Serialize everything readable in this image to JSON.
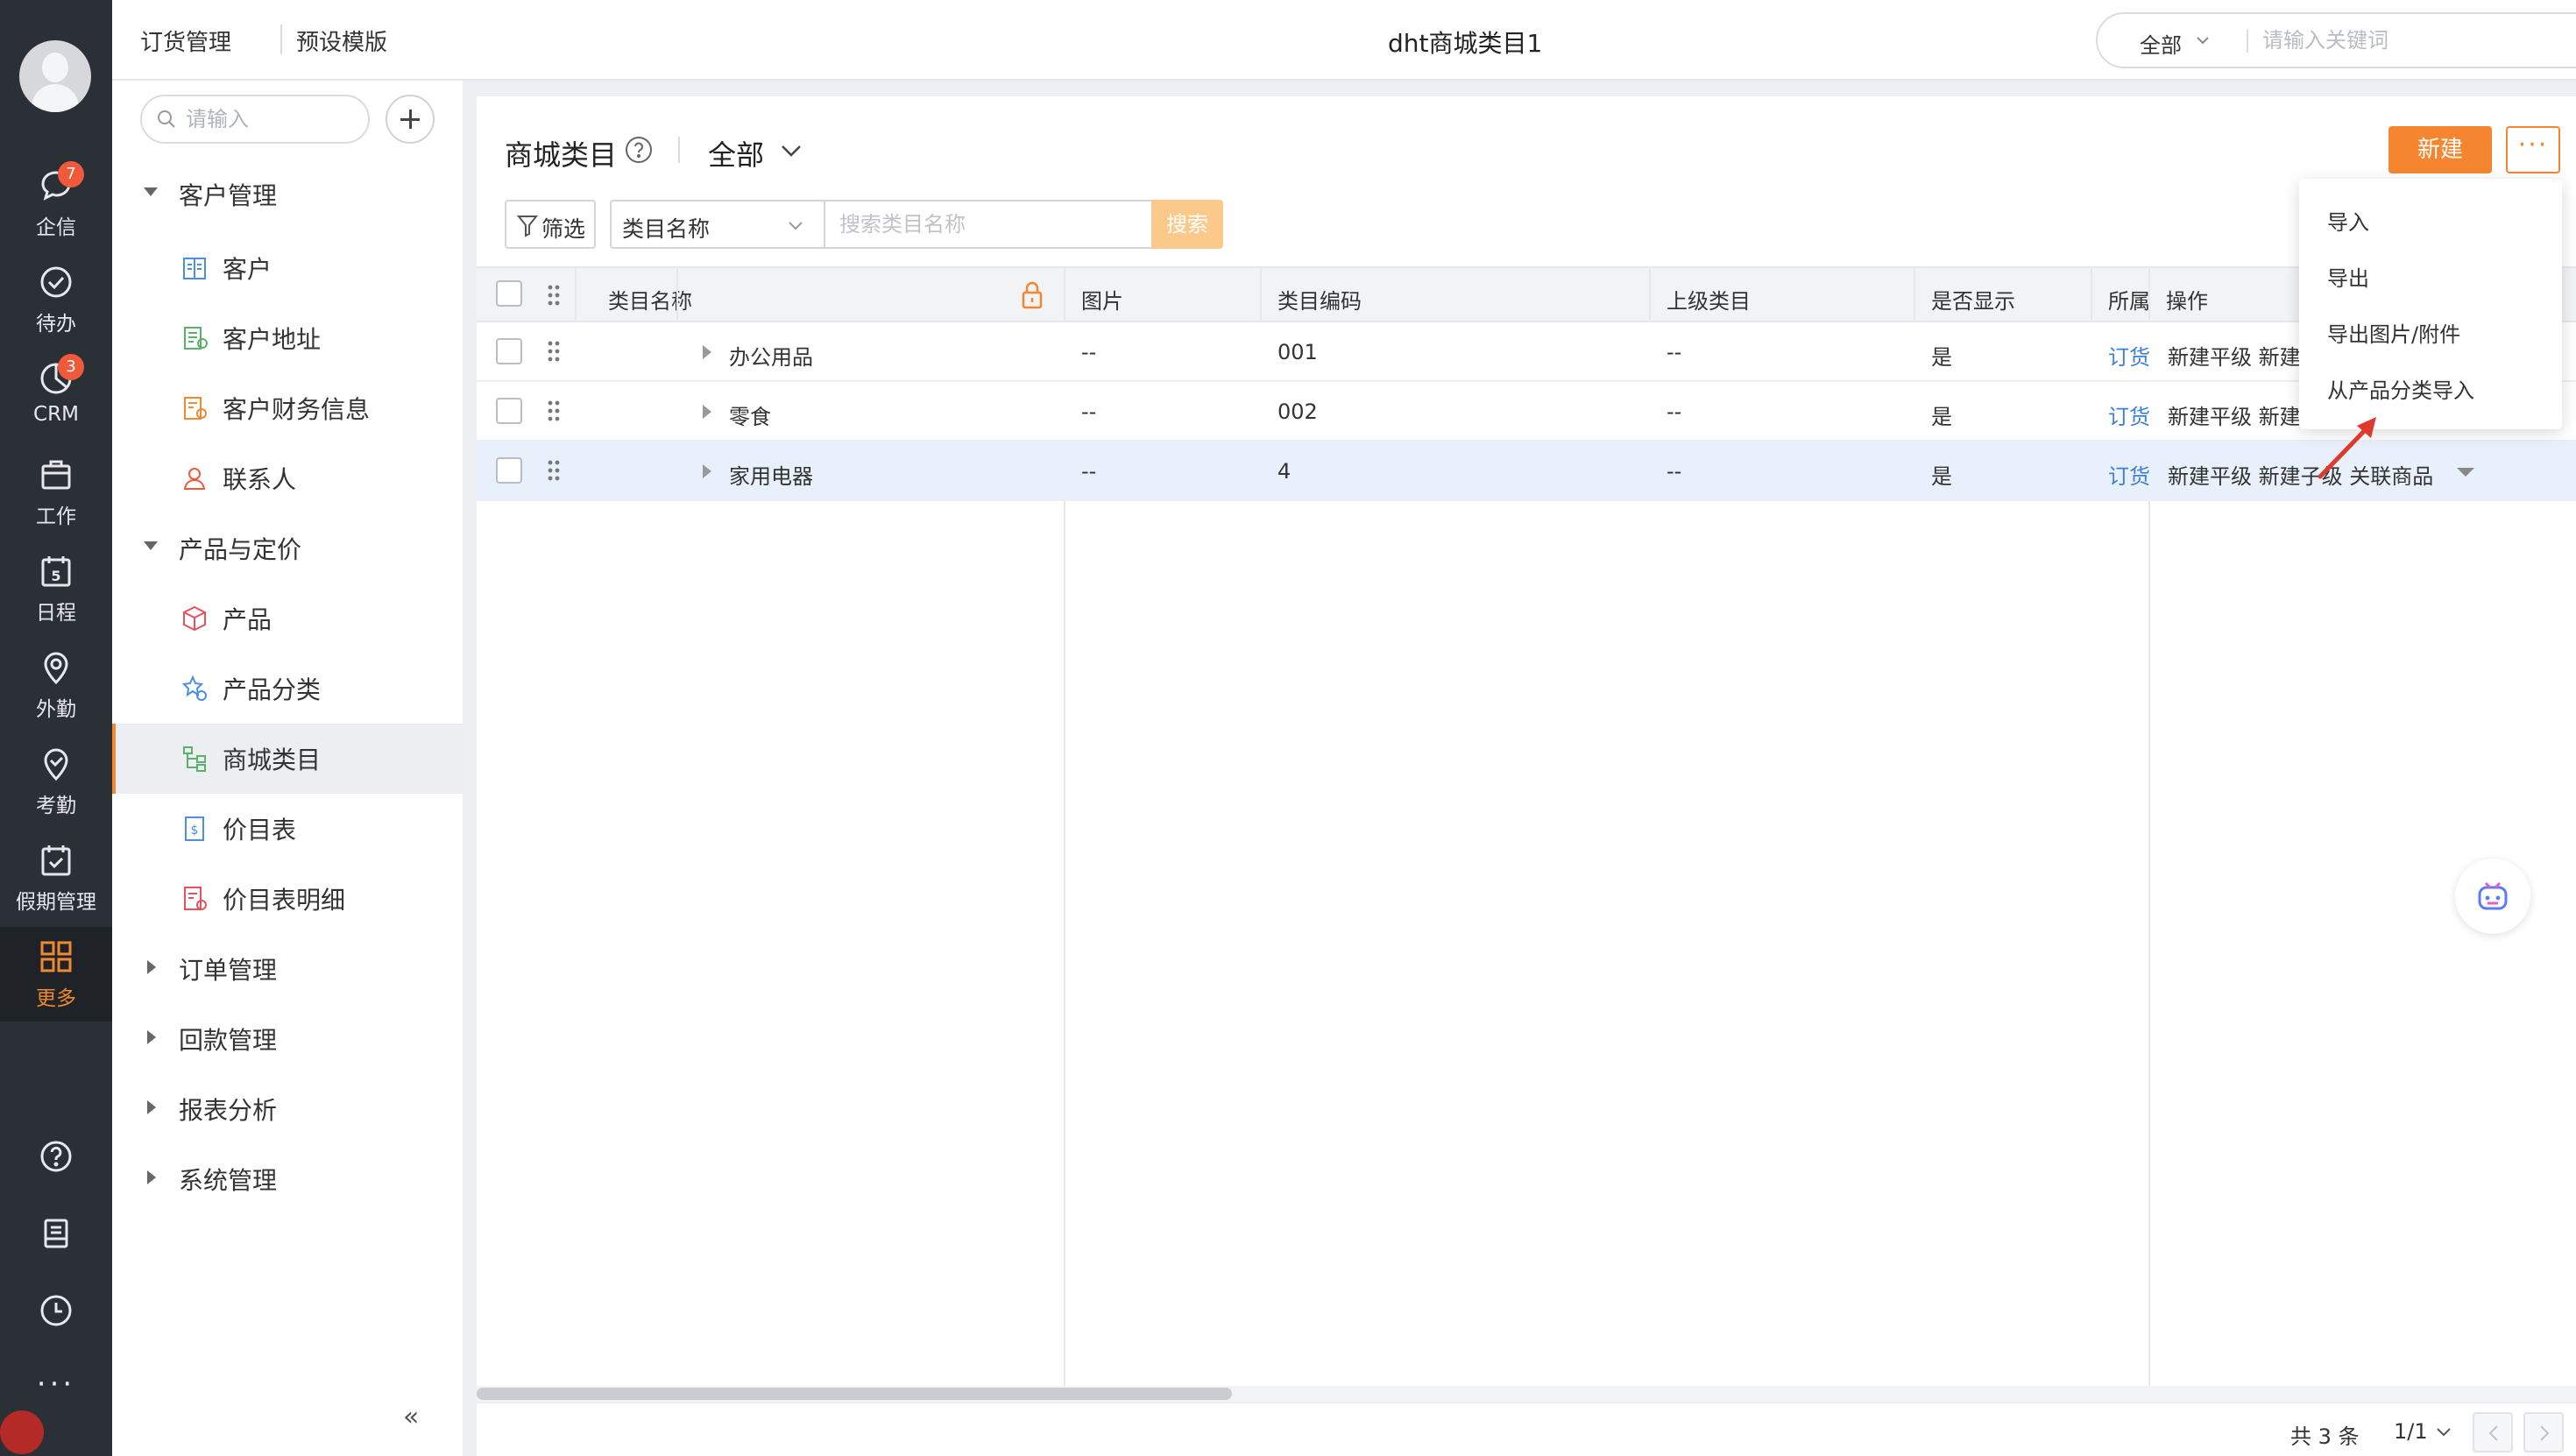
{
  "rail": {
    "items": [
      {
        "label": "企信",
        "icon": "chat-icon",
        "badge": "7"
      },
      {
        "label": "待办",
        "icon": "todo-check-icon",
        "badge": ""
      },
      {
        "label": "CRM",
        "icon": "crm-pie-icon",
        "badge": "3"
      },
      {
        "label": "工作",
        "icon": "briefcase-icon",
        "badge": ""
      },
      {
        "label": "日程",
        "icon": "calendar-icon",
        "badge": "",
        "icon_text": "5"
      },
      {
        "label": "外勤",
        "icon": "location-pin-icon",
        "badge": ""
      },
      {
        "label": "考勤",
        "icon": "attendance-icon",
        "badge": ""
      },
      {
        "label": "假期管理",
        "icon": "leave-calendar-icon",
        "badge": ""
      },
      {
        "label": "更多",
        "icon": "grid-more-icon",
        "badge": "",
        "active": true
      }
    ],
    "more_dots": "···"
  },
  "topbar": {
    "link1": "订货管理",
    "link2": "预设模版",
    "app_title": "dht商城类目1",
    "search_scope": "全部",
    "search_placeholder": "请输入关键词"
  },
  "nav": {
    "search_placeholder": "请输入",
    "groups": [
      {
        "label": "客户管理",
        "expanded": true
      },
      {
        "label": "产品与定价",
        "expanded": true
      },
      {
        "label": "订单管理",
        "expanded": false
      },
      {
        "label": "回款管理",
        "expanded": false
      },
      {
        "label": "报表分析",
        "expanded": false
      },
      {
        "label": "系统管理",
        "expanded": false
      }
    ],
    "items": [
      {
        "label": "客户"
      },
      {
        "label": "客户地址"
      },
      {
        "label": "客户财务信息"
      },
      {
        "label": "联系人"
      },
      {
        "label": "产品"
      },
      {
        "label": "产品分类"
      },
      {
        "label": "商城类目",
        "active": true
      },
      {
        "label": "价目表"
      },
      {
        "label": "价目表明细"
      }
    ],
    "collapse_glyph": "«"
  },
  "main": {
    "title": "商城类目",
    "view": "全部",
    "new_button": "新建",
    "more_button": "···",
    "filter_label": "筛选",
    "field_select": "类目名称",
    "search_placeholder": "搜索类目名称",
    "search_button": "搜索"
  },
  "table": {
    "columns": [
      "类目名称",
      "图片",
      "类目编码",
      "上级类目",
      "是否显示",
      "所属",
      "操作"
    ],
    "rows": [
      {
        "name": "办公用品",
        "image": "--",
        "code": "001",
        "parent": "--",
        "visible": "是",
        "belong": "订货",
        "ops": "新建平级 新建"
      },
      {
        "name": "零食",
        "image": "--",
        "code": "002",
        "parent": "--",
        "visible": "是",
        "belong": "订货",
        "ops": "新建平级 新建"
      },
      {
        "name": "家用电器",
        "image": "--",
        "code": "4",
        "parent": "--",
        "visible": "是",
        "belong": "订货",
        "ops": "新建平级 新建子级 关联商品",
        "highlighted": true
      }
    ],
    "total": "共 3 条",
    "page": "1/1"
  },
  "dropdown": {
    "items": [
      "导入",
      "导出",
      "导出图片/附件",
      "从产品分类导入"
    ]
  },
  "colors": {
    "accent": "#f5862f",
    "rail_bg": "#2b2f36",
    "link": "#3d7fd9",
    "annotation_arrow": "#e0392b"
  }
}
